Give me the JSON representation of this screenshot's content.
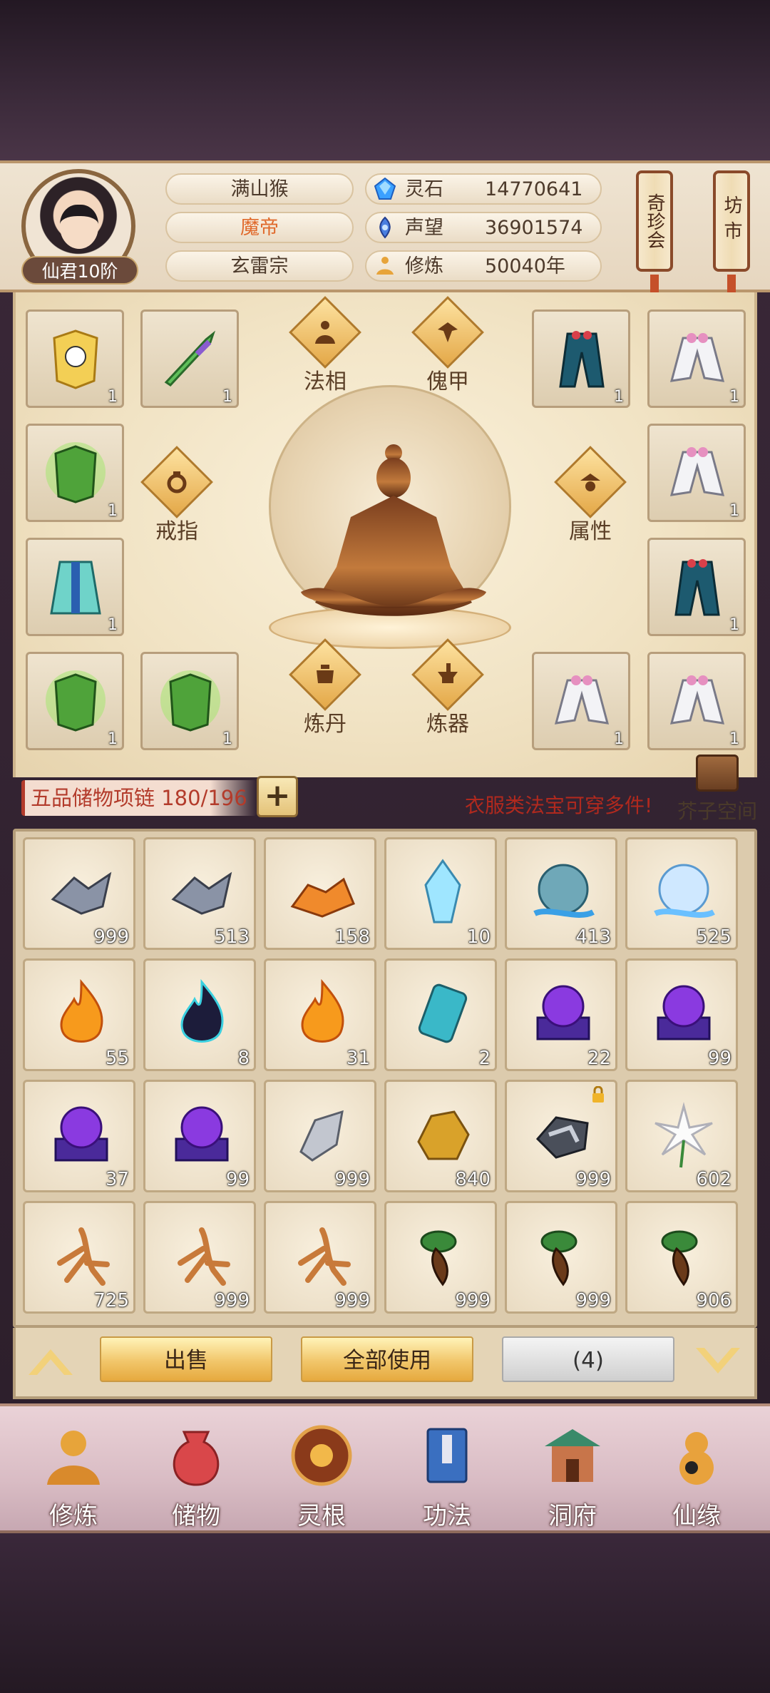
{
  "player": {
    "name": "满山猴",
    "title": "魔帝",
    "sect": "玄雷宗",
    "rank": "仙君10阶"
  },
  "stats": [
    {
      "label": "灵石",
      "value": "14770641",
      "icon": "spirit-stone-icon"
    },
    {
      "label": "声望",
      "value": "36901574",
      "icon": "reputation-icon"
    },
    {
      "label": "修炼",
      "value": "50040年",
      "icon": "cultivation-icon"
    }
  ],
  "side_buttons": [
    "奇珍会",
    "坊市"
  ],
  "equipment_center": {
    "tabs": [
      "法相",
      "傀甲",
      "戒指",
      "属性",
      "炼丹",
      "炼器"
    ]
  },
  "equipment_slots": [
    {
      "count": "1"
    },
    {
      "count": "1"
    },
    {
      "count": "1"
    },
    {
      "count": "1"
    },
    {
      "count": "1"
    },
    {
      "count": "1"
    },
    {
      "count": "1"
    },
    {
      "count": "1"
    },
    {
      "count": "1"
    },
    {
      "count": "1"
    },
    {
      "count": "1"
    },
    {
      "count": "1"
    }
  ],
  "bag": {
    "name": "五品储物项链",
    "capacity": "180/196",
    "hint": "衣服类法宝可穿多件!",
    "space_label": "芥子空间"
  },
  "inventory": [
    {
      "icon": "ore-shards-icon",
      "count": "999"
    },
    {
      "icon": "ore-shards-icon",
      "count": "513"
    },
    {
      "icon": "amber-ore-icon",
      "count": "158"
    },
    {
      "icon": "crystal-icon",
      "count": "10"
    },
    {
      "icon": "water-orb-icon",
      "count": "413"
    },
    {
      "icon": "ice-orb-icon",
      "count": "525"
    },
    {
      "icon": "fire-flame-icon",
      "count": "55"
    },
    {
      "icon": "dark-flame-icon",
      "count": "8"
    },
    {
      "icon": "fire-flame-icon",
      "count": "31"
    },
    {
      "icon": "jade-talisman-icon",
      "count": "2"
    },
    {
      "icon": "purple-orb-icon",
      "count": "22"
    },
    {
      "icon": "purple-orb-icon",
      "count": "99"
    },
    {
      "icon": "purple-orb-icon",
      "count": "37"
    },
    {
      "icon": "purple-orb-icon",
      "count": "99"
    },
    {
      "icon": "silver-ore-icon",
      "count": "999"
    },
    {
      "icon": "gold-nugget-icon",
      "count": "840"
    },
    {
      "icon": "iron-ore-icon",
      "count": "999",
      "locked": true
    },
    {
      "icon": "white-flower-icon",
      "count": "602"
    },
    {
      "icon": "ginseng-icon",
      "count": "725"
    },
    {
      "icon": "ginseng-icon",
      "count": "999"
    },
    {
      "icon": "ginseng-icon",
      "count": "999"
    },
    {
      "icon": "herb-root-icon",
      "count": "999"
    },
    {
      "icon": "herb-root-icon",
      "count": "999"
    },
    {
      "icon": "herb-root-icon",
      "count": "906"
    }
  ],
  "actions": {
    "sell": "出售",
    "use_all": "全部使用",
    "selected": "(4)"
  },
  "nav": [
    "修炼",
    "储物",
    "灵根",
    "功法",
    "洞府",
    "仙缘"
  ]
}
